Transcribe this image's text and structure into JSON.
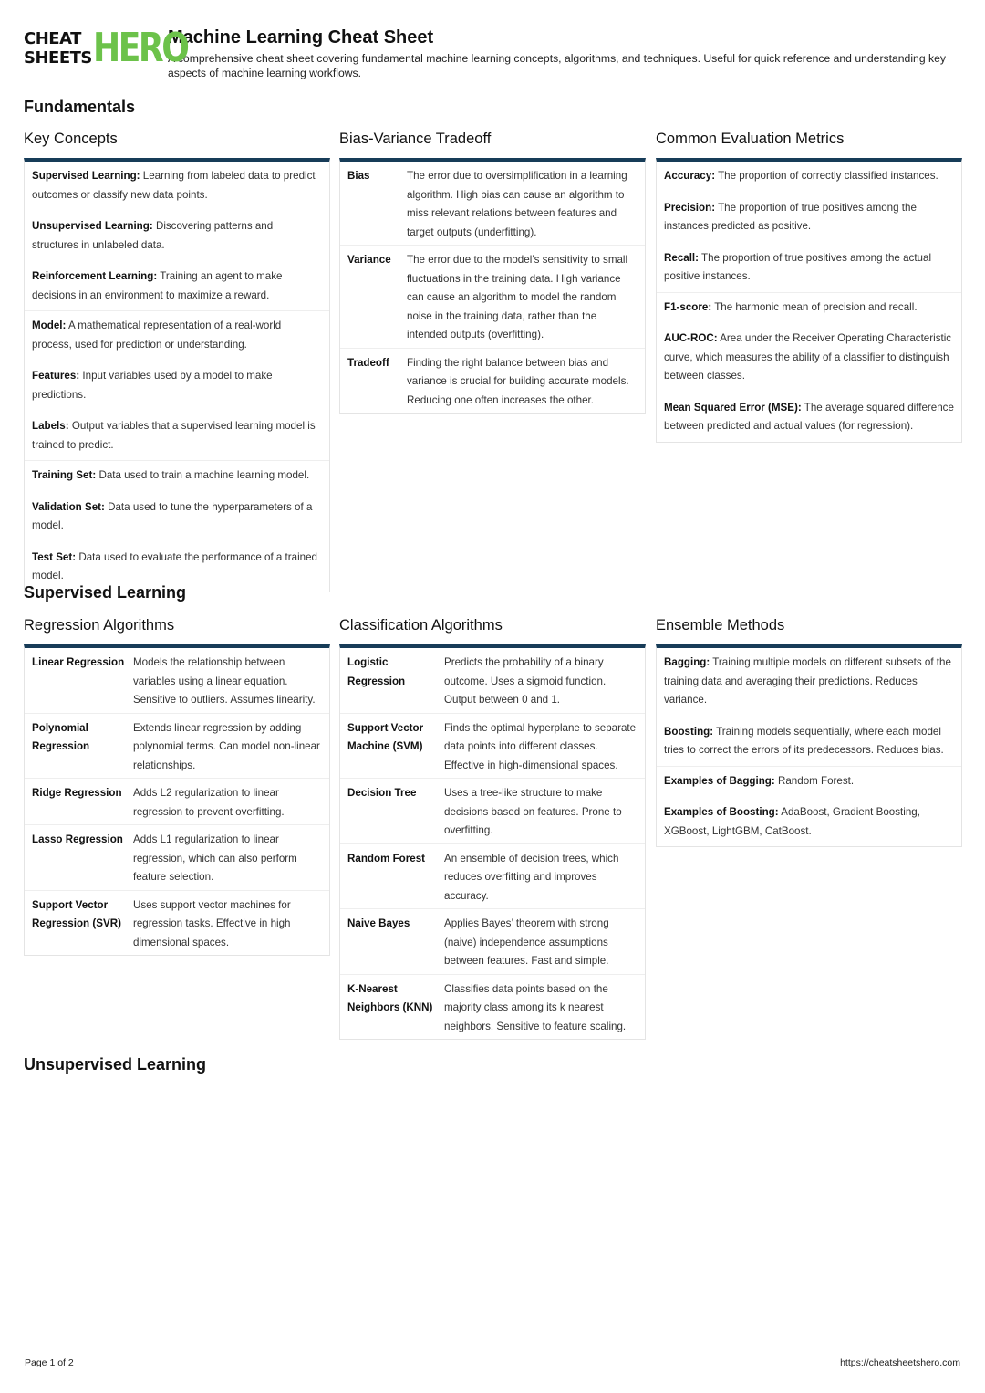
{
  "logo": {
    "cheat": "CHEAT",
    "sheets": "SHEETS",
    "hero": "HERO"
  },
  "header": {
    "title": "Machine Learning Cheat Sheet",
    "description": "A comprehensive cheat sheet covering fundamental machine learning concepts, algorithms, and techniques. Useful for quick reference and understanding key aspects of machine learning workflows."
  },
  "sections": {
    "fundamentals": "Fundamentals",
    "supervised": "Supervised Learning",
    "unsupervised": "Unsupervised Learning"
  },
  "key_concepts": {
    "title": "Key Concepts",
    "groups": [
      [
        {
          "term": "Supervised Learning:",
          "text": " Learning from labeled data to predict outcomes or classify new data points."
        },
        {
          "term": "Unsupervised Learning:",
          "text": " Discovering patterns and structures in unlabeled data."
        },
        {
          "term": "Reinforcement Learning:",
          "text": " Training an agent to make decisions in an environment to maximize a reward."
        }
      ],
      [
        {
          "term": "Model:",
          "text": " A mathematical representation of a real-world process, used for prediction or understanding."
        },
        {
          "term": "Features:",
          "text": " Input variables used by a model to make predictions."
        },
        {
          "term": "Labels:",
          "text": " Output variables that a supervised learning model is trained to predict."
        }
      ],
      [
        {
          "term": "Training Set:",
          "text": " Data used to train a machine learning model."
        },
        {
          "term": "Validation Set:",
          "text": " Data used to tune the hyperparameters of a model."
        },
        {
          "term": "Test Set:",
          "text": " Data used to evaluate the performance of a trained model."
        }
      ]
    ]
  },
  "bias_variance": {
    "title": "Bias-Variance Tradeoff",
    "rows": [
      {
        "term": "Bias",
        "text": "The error due to oversimplification in a learning algorithm. High bias can cause an algorithm to miss relevant relations between features and target outputs (underfitting)."
      },
      {
        "term": "Variance",
        "text": "The error due to the model’s sensitivity to small fluctuations in the training data. High variance can cause an algorithm to model the random noise in the training data, rather than the intended outputs (overfitting)."
      },
      {
        "term": "Tradeoff",
        "text": "Finding the right balance between bias and variance is crucial for building accurate models. Reducing one often increases the other."
      }
    ]
  },
  "metrics": {
    "title": "Common Evaluation Metrics",
    "groups": [
      [
        {
          "term": "Accuracy:",
          "text": " The proportion of correctly classified instances."
        },
        {
          "term": "Precision:",
          "text": " The proportion of true positives among the instances predicted as positive."
        },
        {
          "term": "Recall:",
          "text": " The proportion of true positives among the actual positive instances."
        }
      ],
      [
        {
          "term": "F1-score:",
          "text": " The harmonic mean of precision and recall."
        },
        {
          "term": "AUC-ROC:",
          "text": " Area under the Receiver Operating Characteristic curve, which measures the ability of a classifier to distinguish between classes."
        },
        {
          "term": "Mean Squared Error (MSE):",
          "text": " The average squared difference between predicted and actual values (for regression)."
        }
      ]
    ]
  },
  "regression": {
    "title": "Regression Algorithms",
    "rows": [
      {
        "term": "Linear Regression",
        "text": "Models the relationship between variables using a linear equation. Sensitive to outliers. Assumes linearity."
      },
      {
        "term": "Polynomial Regression",
        "text": "Extends linear regression by adding polynomial terms. Can model non-linear relationships."
      },
      {
        "term": "Ridge Regression",
        "text": "Adds L2 regularization to linear regression to prevent overfitting."
      },
      {
        "term": "Lasso Regression",
        "text": "Adds L1 regularization to linear regression, which can also perform feature selection."
      },
      {
        "term": "Support Vector Regression (SVR)",
        "text": "Uses support vector machines for regression tasks. Effective in high dimensional spaces."
      }
    ]
  },
  "classification": {
    "title": "Classification Algorithms",
    "rows": [
      {
        "term": "Logistic Regression",
        "text": "Predicts the probability of a binary outcome. Uses a sigmoid function. Output between 0 and 1."
      },
      {
        "term": "Support Vector Machine (SVM)",
        "text": "Finds the optimal hyperplane to separate data points into different classes. Effective in high-dimensional spaces."
      },
      {
        "term": "Decision Tree",
        "text": "Uses a tree-like structure to make decisions based on features. Prone to overfitting."
      },
      {
        "term": "Random Forest",
        "text": "An ensemble of decision trees, which reduces overfitting and improves accuracy."
      },
      {
        "term": "Naive Bayes",
        "text": "Applies Bayes’ theorem with strong (naive) independence assumptions between features. Fast and simple."
      },
      {
        "term": "K-Nearest Neighbors (KNN)",
        "text": "Classifies data points based on the majority class among its k nearest neighbors. Sensitive to feature scaling."
      }
    ]
  },
  "ensemble": {
    "title": "Ensemble Methods",
    "groups": [
      [
        {
          "term": "Bagging:",
          "text": " Training multiple models on different subsets of the training data and averaging their predictions. Reduces variance."
        },
        {
          "term": "Boosting:",
          "text": " Training models sequentially, where each model tries to correct the errors of its predecessors. Reduces bias."
        }
      ],
      [
        {
          "term": "Examples of Bagging:",
          "text": " Random Forest."
        },
        {
          "term": "Examples of Boosting:",
          "text": " AdaBoost, Gradient Boosting, XGBoost, LightGBM, CatBoost."
        }
      ]
    ]
  },
  "footer": {
    "page": "Page 1 of 2",
    "url": "https://cheatsheetshero.com"
  },
  "colors": {
    "accent_bar": "#173c58",
    "logo_green": "#6cc24a"
  }
}
